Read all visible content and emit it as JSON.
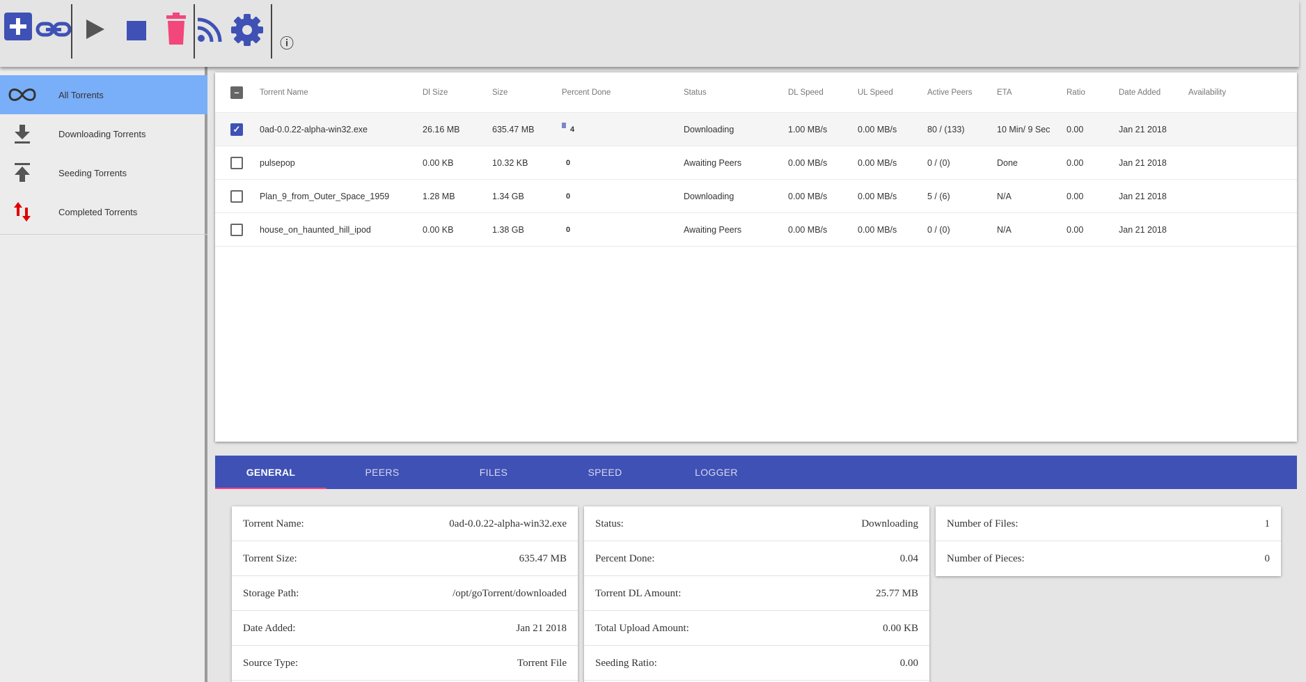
{
  "toolbar": {
    "icons": [
      "add-torrent-icon",
      "add-magnet-link-icon",
      "start-icon",
      "stop-icon",
      "delete-icon",
      "rss-icon",
      "settings-icon",
      "info-icon"
    ],
    "info_glyph": "ⓘ"
  },
  "sidebar": {
    "items": [
      {
        "label": "All Torrents",
        "icon": "infinity-icon"
      },
      {
        "label": "Downloading Torrents",
        "icon": "download-icon"
      },
      {
        "label": "Seeding Torrents",
        "icon": "upload-icon"
      },
      {
        "label": "Completed Torrents",
        "icon": "swap-vertical-icon"
      }
    ]
  },
  "table": {
    "columns": [
      "Torrent Name",
      "Dl Size",
      "Size",
      "Percent Done",
      "Status",
      "DL Speed",
      "UL Speed",
      "Active Peers",
      "ETA",
      "Ratio",
      "Date Added",
      "Availability"
    ],
    "rows": [
      {
        "name": "0ad-0.0.22-alpha-win32.exe",
        "dl_size": "26.16 MB",
        "size": "635.47 MB",
        "percent": "4",
        "status": "Downloading",
        "dl_speed": "1.00 MB/s",
        "ul_speed": "0.00 MB/s",
        "peers": "80 / (133)",
        "eta": "10 Min/ 9 Sec",
        "ratio": "0.00",
        "date_added": "Jan 21 2018",
        "availability": "",
        "checked": true
      },
      {
        "name": "pulsepop",
        "dl_size": "0.00 KB",
        "size": "10.32 KB",
        "percent": "0",
        "status": "Awaiting Peers",
        "dl_speed": "0.00 MB/s",
        "ul_speed": "0.00 MB/s",
        "peers": "0 / (0)",
        "eta": "Done",
        "ratio": "0.00",
        "date_added": "Jan 21 2018",
        "availability": "",
        "checked": false
      },
      {
        "name": "Plan_9_from_Outer_Space_1959",
        "dl_size": "1.28 MB",
        "size": "1.34 GB",
        "percent": "0",
        "status": "Downloading",
        "dl_speed": "0.00 MB/s",
        "ul_speed": "0.00 MB/s",
        "peers": "5 / (6)",
        "eta": "N/A",
        "ratio": "0.00",
        "date_added": "Jan 21 2018",
        "availability": "",
        "checked": false
      },
      {
        "name": "house_on_haunted_hill_ipod",
        "dl_size": "0.00 KB",
        "size": "1.38 GB",
        "percent": "0",
        "status": "Awaiting Peers",
        "dl_speed": "0.00 MB/s",
        "ul_speed": "0.00 MB/s",
        "peers": "0 / (0)",
        "eta": "N/A",
        "ratio": "0.00",
        "date_added": "Jan 21 2018",
        "availability": "",
        "checked": false
      }
    ]
  },
  "tabs": [
    "GENERAL",
    "PEERS",
    "FILES",
    "SPEED",
    "LOGGER"
  ],
  "details": {
    "col1": [
      {
        "key": "Torrent Name:",
        "value": "0ad-0.0.22-alpha-win32.exe"
      },
      {
        "key": "Torrent Size:",
        "value": "635.47 MB"
      },
      {
        "key": "Storage Path:",
        "value": "/opt/goTorrent/downloaded"
      },
      {
        "key": "Date Added:",
        "value": "Jan 21 2018"
      },
      {
        "key": "Source Type:",
        "value": "Torrent File"
      }
    ],
    "col2": [
      {
        "key": "Status:",
        "value": "Downloading"
      },
      {
        "key": "Percent Done:",
        "value": "0.04"
      },
      {
        "key": "Torrent DL Amount:",
        "value": "25.77 MB"
      },
      {
        "key": "Total Upload Amount:",
        "value": "0.00 KB"
      },
      {
        "key": "Seeding Ratio:",
        "value": "0.00"
      }
    ],
    "col3": [
      {
        "key": "Number of Files:",
        "value": "1"
      },
      {
        "key": "Number of Pieces:",
        "value": "0"
      }
    ]
  },
  "colors": {
    "primary": "#3f51b5",
    "accent": "#ff4081",
    "sidebar_active": "#79aef8",
    "check_mark": "#ffffff"
  }
}
